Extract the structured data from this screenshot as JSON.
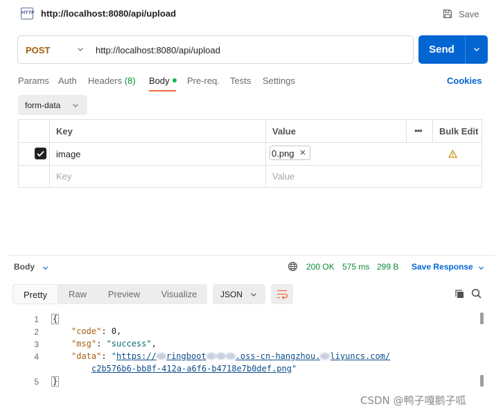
{
  "titlebar": {
    "icon_text": "HTTP",
    "icon_name": "http-icon",
    "title": "http://localhost:8080/api/upload",
    "save_label": "Save"
  },
  "request": {
    "method": "POST",
    "url": "http://localhost:8080/api/upload",
    "send_label": "Send"
  },
  "tabs": {
    "items": [
      {
        "label": "Params"
      },
      {
        "label": "Auth"
      },
      {
        "label": "Headers",
        "count": "(8)"
      },
      {
        "label": "Body",
        "active": true
      },
      {
        "label": "Pre-req."
      },
      {
        "label": "Tests"
      },
      {
        "label": "Settings"
      }
    ],
    "cookies_label": "Cookies"
  },
  "body_mode": "form-data",
  "form_table": {
    "headers": {
      "key": "Key",
      "value": "Value",
      "more": "•••",
      "bulk_edit": "Bulk Edit"
    },
    "rows": [
      {
        "checked": true,
        "key": "image",
        "value": "0.png"
      }
    ],
    "empty_row": {
      "key_placeholder": "Key",
      "value_placeholder": "Value"
    }
  },
  "response": {
    "section_label": "Body",
    "status": "200 OK",
    "time": "575 ms",
    "size": "299 B",
    "save_response_label": "Save Response",
    "view_tabs": [
      {
        "label": "Pretty",
        "active": true
      },
      {
        "label": "Raw"
      },
      {
        "label": "Preview"
      },
      {
        "label": "Visualize"
      }
    ],
    "format": "JSON",
    "lines": {
      "n1": "1",
      "n2": "2",
      "n3": "3",
      "n4": "4",
      "n5": "5",
      "open": "{",
      "close": "}",
      "code_key": "\"code\"",
      "code_val": "0",
      "msg_key": "\"msg\"",
      "msg_val": "\"success\"",
      "data_key": "\"data\"",
      "data_part1": "https://",
      "data_part2": "ringboot",
      "data_part3": ".oss-cn-hangzhou.",
      "data_part4": "liyuncs.com/",
      "data_line2": "c2b576b6-bb8f-412a-a6f6-b4718e7b0def.png"
    }
  },
  "watermark": "CSDN @鸭子嘎鹅子呱",
  "colors": {
    "accent_blue": "#0265d2",
    "method_orange": "#a35e0e",
    "status_green": "#0c8a3a",
    "tab_underline": "#f26b3a"
  }
}
